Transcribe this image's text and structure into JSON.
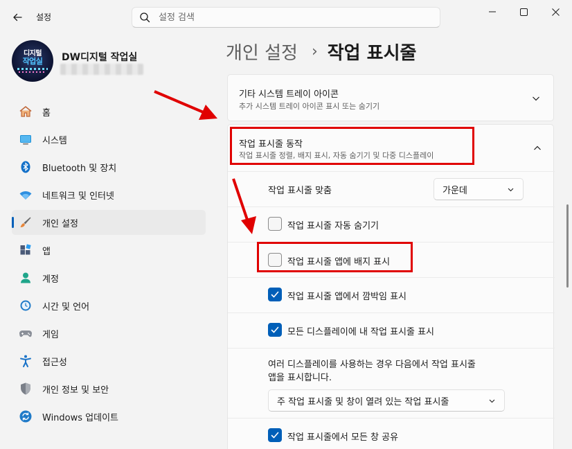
{
  "app": {
    "title": "설정",
    "search_placeholder": "설정 검색"
  },
  "profile": {
    "name": "DW디지털 작업실",
    "avatar_line1": "디지털",
    "avatar_line2": "작업실"
  },
  "sidebar": {
    "items": [
      {
        "label": "홈",
        "icon": "home-icon",
        "active": false
      },
      {
        "label": "시스템",
        "icon": "system-icon",
        "active": false
      },
      {
        "label": "Bluetooth 및 장치",
        "icon": "bluetooth-icon",
        "active": false
      },
      {
        "label": "네트워크 및 인터넷",
        "icon": "wifi-icon",
        "active": false
      },
      {
        "label": "개인 설정",
        "icon": "brush-icon",
        "active": true
      },
      {
        "label": "앱",
        "icon": "apps-icon",
        "active": false
      },
      {
        "label": "계정",
        "icon": "account-icon",
        "active": false
      },
      {
        "label": "시간 및 언어",
        "icon": "clock-globe-icon",
        "active": false
      },
      {
        "label": "게임",
        "icon": "gamepad-icon",
        "active": false
      },
      {
        "label": "접근성",
        "icon": "accessibility-icon",
        "active": false
      },
      {
        "label": "개인 정보 및 보안",
        "icon": "shield-icon",
        "active": false
      },
      {
        "label": "Windows 업데이트",
        "icon": "update-icon",
        "active": false
      }
    ]
  },
  "header": {
    "crumb1": "개인 설정",
    "separator": "›",
    "crumb2": "작업 표시줄"
  },
  "tray_card": {
    "title": "기타 시스템 트레이 아이콘",
    "desc": "추가 시스템 트레이 아이콘 표시 또는 숨기기"
  },
  "behavior_card": {
    "title": "작업 표시줄 동작",
    "desc": "작업 표시줄 정렬, 배지 표시, 자동 숨기기 및 다중 디스플레이",
    "alignment_label": "작업 표시줄 맞춤",
    "alignment_value": "가운데",
    "auto_hide_label": "작업 표시줄 자동 숨기기",
    "auto_hide_checked": false,
    "badges_label": "작업 표시줄 앱에 배지 표시",
    "badges_checked": false,
    "flashing_label": "작업 표시줄 앱에서 깜박임 표시",
    "flashing_checked": true,
    "all_displays_label": "모든 디스플레이에 내 작업 표시줄 표시",
    "all_displays_checked": true,
    "multi_display_text_line1": "여러 디스플레이를 사용하는 경우 다음에서 작업 표시줄",
    "multi_display_text_line2": "앱을 표시합니다.",
    "multi_display_value": "주 작업 표시줄 및 창이 열려 있는 작업 표시줄",
    "share_windows_label": "작업 표시줄에서 모든 창 공유",
    "share_windows_checked": true
  },
  "colors": {
    "accent": "#005fb8",
    "highlight": "#e00000",
    "background": "#f3f3f3",
    "card": "#fbfbfb"
  }
}
